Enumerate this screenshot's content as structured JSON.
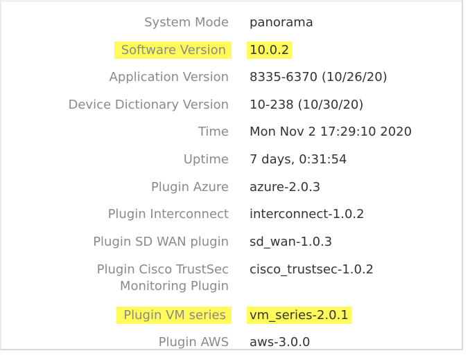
{
  "info_panel": {
    "rows": [
      {
        "label": "System Mode",
        "value": "panorama"
      },
      {
        "label": "Software Version",
        "value": "10.0.2"
      },
      {
        "label": "Application Version",
        "value": "8335-6370 (10/26/20)"
      },
      {
        "label": "Device Dictionary Version",
        "value": "10-238 (10/30/20)"
      },
      {
        "label": "Time",
        "value": "Mon Nov 2 17:29:10 2020"
      },
      {
        "label": "Uptime",
        "value": "7 days, 0:31:54"
      },
      {
        "label": "Plugin Azure",
        "value": "azure-2.0.3"
      },
      {
        "label": "Plugin Interconnect",
        "value": "interconnect-1.0.2"
      },
      {
        "label": "Plugin SD WAN plugin",
        "value": "sd_wan-1.0.3"
      },
      {
        "label_line1": "Plugin Cisco TrustSec",
        "label_line2": "Monitoring Plugin",
        "value": "cisco_trustsec-1.0.2"
      },
      {
        "label": "Plugin VM series",
        "value": "vm_series-2.0.1"
      },
      {
        "label": "Plugin AWS",
        "value": "aws-3.0.0"
      }
    ],
    "highlight_color": "#fffb5a"
  }
}
